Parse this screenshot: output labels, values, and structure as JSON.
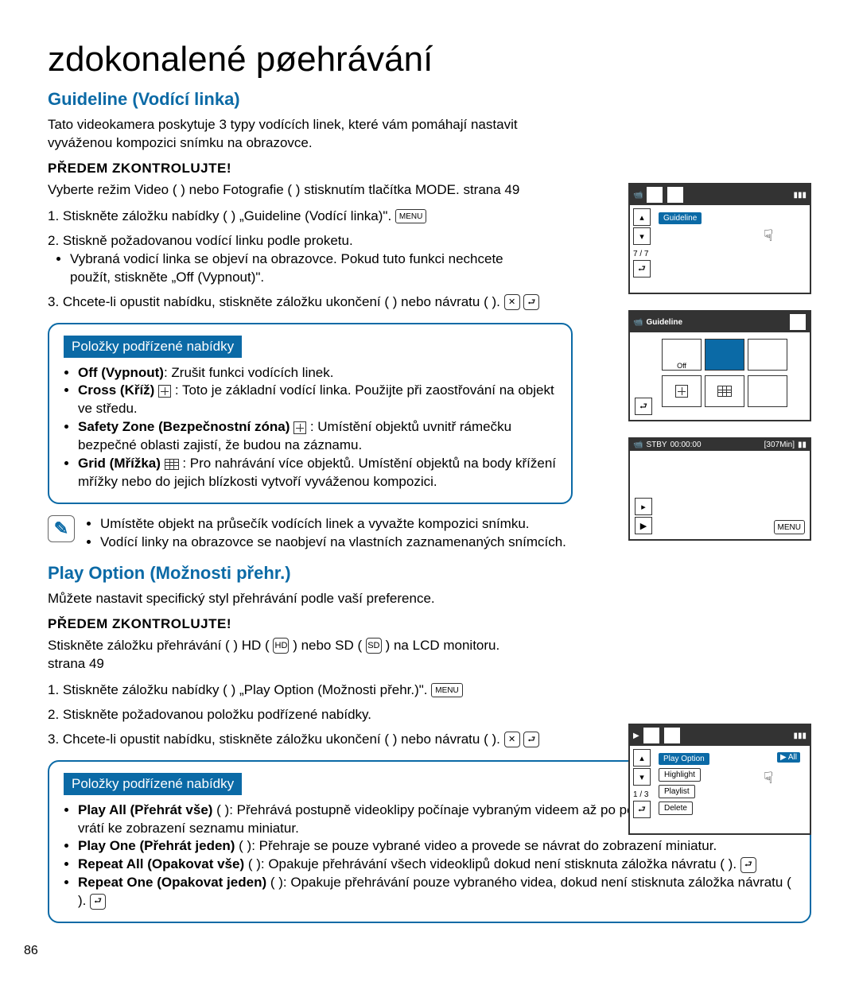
{
  "page": {
    "number": "86",
    "title": "zdokonalené pøehrávání"
  },
  "guideline": {
    "heading": "Guideline (Vodící linka)",
    "intro": "Tato videokamera poskytuje 3 typy vodících linek, které vám pomáhají nastavit vyváženou kompozici snímku na obrazovce.",
    "precheck_label": "PŘEDEM ZKONTROLUJTE!",
    "precheck_text": "Vyberte režim Video (   ) nebo Fotografie (   ) stisknutím tlačítka MODE.   strana 49",
    "steps": [
      "1. Stiskněte záložku nabídky (    )   „Guideline (Vodící linka)\".",
      "2. Stiskně požadovanou vodící linku podle proketu.",
      "3. Chcete-li opustit nabídku, stiskněte záložku ukončení (   ) nebo návratu (   )."
    ],
    "sub": [
      "Vybraná vodicí linka se objeví na obrazovce. Pokud tuto funkci nechcete použít, stiskněte „Off (Vypnout)\"."
    ],
    "callout_title": "Položky podřízené nabídky",
    "callout_items": [
      {
        "name": "Off (Vypnout)",
        "desc": ": Zrušit funkci vodících linek."
      },
      {
        "name": "Cross (Kříž)",
        "desc": " : Toto je základní vodící linka. Použijte při zaostřování na objekt ve středu."
      },
      {
        "name": "Safety Zone (Bezpečnostní zóna)",
        "desc": " : Umístění objektů uvnitř rámečku bezpečné oblasti zajistí, že budou na záznamu."
      },
      {
        "name": "Grid (Mřížka)",
        "desc": " : Pro nahrávání více objektů. Umístění objektů na body křížení mřížky nebo do jejich blízkosti vytvoří vyváženou kompozici."
      }
    ],
    "tips": [
      "Umístěte objekt na průsečík vodících linek a vyvažte kompozici snímku.",
      "Vodící linky na obrazovce se naobjeví na vlastních zaznamenaných snímcích."
    ],
    "lcd1": {
      "title": "Guideline",
      "count": "7 / 7"
    },
    "lcd2": {
      "title": "Guideline",
      "sub": "Off"
    },
    "lcd3": {
      "status": "STBY",
      "time": "00:00:00",
      "remain": "[307Min]",
      "menu": "MENU"
    }
  },
  "playoption": {
    "heading": "Play Option (Možnosti přehr.)",
    "intro": "Můžete nastavit specifický styl přehrávání podle vaší preference.",
    "precheck_label": "PŘEDEM ZKONTROLUJTE!",
    "precheck_text_a": "Stiskněte záložku přehrávání (   )   HD (",
    "precheck_text_b": ") nebo SD (",
    "precheck_text_c": ") na LCD monitoru.   strana 49",
    "steps": [
      "1. Stiskněte záložku nabídky (    )   „Play Option (Možnosti přehr.)\".",
      "2. Stiskněte požadovanou položku podřízené nabídky.",
      "3. Chcete-li opustit nabídku, stiskněte záložku ukončení (   ) nebo návratu (   )."
    ],
    "callout_title": "Položky podřízené nabídky",
    "callout_items": [
      {
        "name": "Play All (Přehrát vše)",
        "desc": " (   ): Přehrává postupně videoklipy počínaje vybraným videem až po poslední video a potom se vrátí ke zobrazení seznamu miniatur."
      },
      {
        "name": "Play One (Přehrát jeden)",
        "desc": " (   ): Přehraje se pouze vybrané video a provede se návrat do zobrazení miniatur."
      },
      {
        "name": "Repeat All (Opakovat vše)",
        "desc": " (   ): Opakuje přehrávání všech videoklipů dokud není stisknuta záložka návratu (   )."
      },
      {
        "name": "Repeat One (Opakovat jeden)",
        "desc": " (   ): Opakuje přehrávání pouze vybraného videa, dokud není stisknuta záložka návratu (   )."
      }
    ],
    "lcd": {
      "title": "Play Option",
      "items": [
        "Highlight",
        "Playlist",
        "Delete"
      ],
      "selected": "All",
      "count": "1 / 3"
    }
  }
}
